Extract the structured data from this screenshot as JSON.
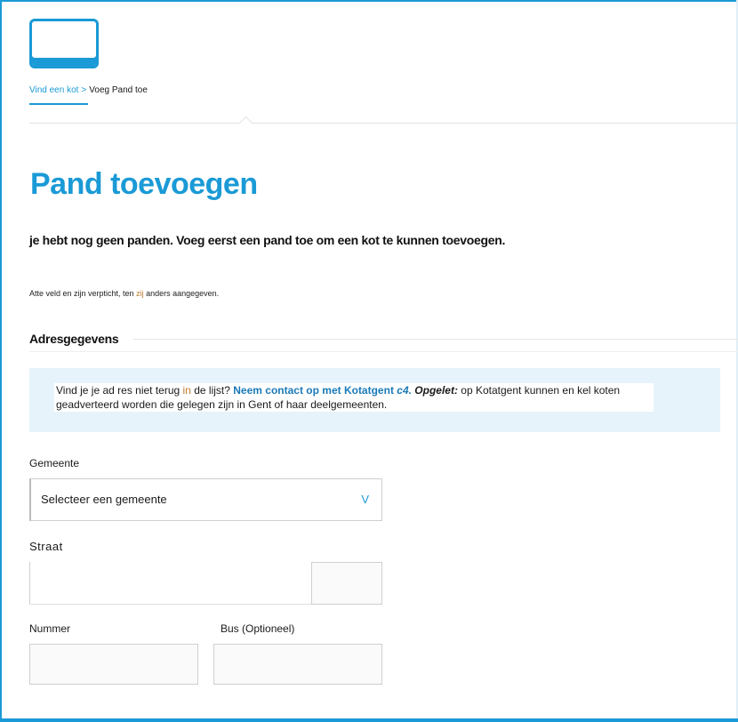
{
  "breadcrumb": {
    "home": "Vind een kot",
    "separator": ">",
    "current": "Voeg Pand toe"
  },
  "page": {
    "title": "Pand toevoegen",
    "intro": "je hebt nog geen panden. Voeg eerst een pand toe om een kot te kunnen toevoegen.",
    "required_note_a": "Atte veld en zijn verpticht, ten ",
    "required_note_b": "zij",
    "required_note_c": " anders aangegeven."
  },
  "section": {
    "title": "Adresgegevens"
  },
  "info": {
    "part1": "Vind je je ad res niet terug ",
    "part2": "in",
    "part3": " de lijst? ",
    "link": "Neem contact op met Kotatgent",
    "link_suffix": " c4.",
    "warn_label": " Opgelet:",
    "part4": " op Kotatgent kunnen en kel koten geadverteerd worden die gelegen zijn in Gent of haar deelgemeenten."
  },
  "form": {
    "gemeente_label": "Gemeente",
    "gemeente_value": "Selecteer een gemeente",
    "gemeente_chevron": "V",
    "straat_label": "Straat",
    "nummer_label": "Nummer",
    "bus_label": "Bus (Optioneel)"
  },
  "colors": {
    "accent": "#1a9ad6",
    "info_bg": "#e6f3fb"
  }
}
